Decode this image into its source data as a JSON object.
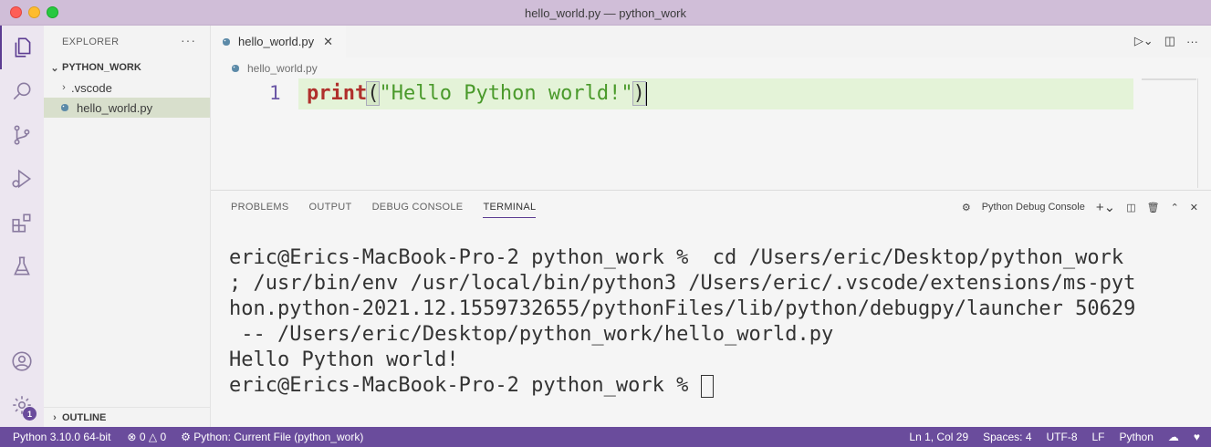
{
  "window": {
    "title": "hello_world.py — python_work"
  },
  "sidebar": {
    "header": "EXPLORER",
    "more": "···",
    "folder": "PYTHON_WORK",
    "items": [
      {
        "label": ".vscode",
        "type": "folder"
      },
      {
        "label": "hello_world.py",
        "type": "python-file",
        "selected": true
      }
    ],
    "outline": "OUTLINE"
  },
  "activity": {
    "settings_badge": "1"
  },
  "editor": {
    "tab_label": "hello_world.py",
    "breadcrumb": "hello_world.py",
    "line_number": "1",
    "code": {
      "keyword": "print",
      "open_paren": "(",
      "string": "\"Hello Python world!\"",
      "close_paren": ")"
    }
  },
  "panel": {
    "tabs": [
      "PROBLEMS",
      "OUTPUT",
      "DEBUG CONSOLE",
      "TERMINAL"
    ],
    "active_tab": "TERMINAL",
    "terminal_selector": "Python Debug Console",
    "terminal_lines": [
      "eric@Erics-MacBook-Pro-2 python_work %  cd /Users/eric/Desktop/python_work",
      "; /usr/bin/env /usr/local/bin/python3 /Users/eric/.vscode/extensions/ms-pyt",
      "hon.python-2021.12.1559732655/pythonFiles/lib/python/debugpy/launcher 50629",
      " -- /Users/eric/Desktop/python_work/hello_world.py",
      "Hello Python world!"
    ],
    "prompt": "eric@Erics-MacBook-Pro-2 python_work % "
  },
  "statusbar": {
    "interpreter": "Python 3.10.0 64-bit",
    "errors": "0",
    "warnings": "0",
    "run_config": "Python: Current File (python_work)",
    "position": "Ln 1, Col 29",
    "spaces": "Spaces: 4",
    "encoding": "UTF-8",
    "eol": "LF",
    "language": "Python"
  },
  "colors": {
    "statusbar": "#6a4c9c",
    "titlebar": "#d0bed8",
    "line_highlight": "#e4f3d8"
  }
}
